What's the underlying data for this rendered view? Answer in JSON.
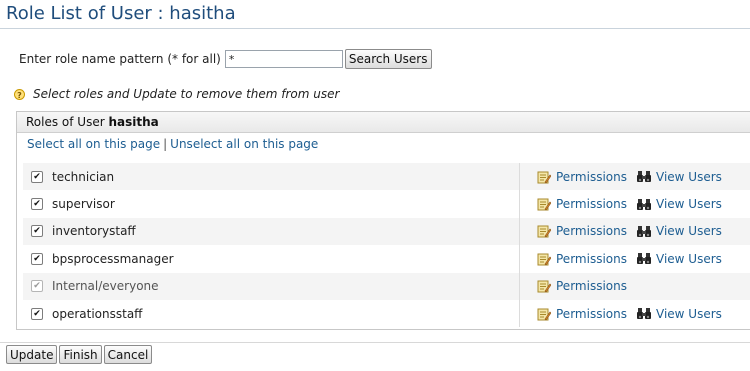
{
  "page": {
    "title": "Role List of User : hasitha"
  },
  "search": {
    "label": "Enter role name pattern (* for all)",
    "value": "*",
    "button_label": "Search Users"
  },
  "hint": {
    "icon": "help-icon",
    "text": "Select roles and Update to remove them from user"
  },
  "panel": {
    "header_prefix": "Roles of User",
    "header_user": "hasitha",
    "select_all_label": "Select all on this page",
    "separator": "|",
    "unselect_all_label": "Unselect all on this page"
  },
  "roles": [
    {
      "name": "technician",
      "checked": true,
      "disabled": false,
      "permissions_label": "Permissions",
      "view_users_label": "View Users"
    },
    {
      "name": "supervisor",
      "checked": true,
      "disabled": false,
      "permissions_label": "Permissions",
      "view_users_label": "View Users"
    },
    {
      "name": "inventorystaff",
      "checked": true,
      "disabled": false,
      "permissions_label": "Permissions",
      "view_users_label": "View Users"
    },
    {
      "name": "bpsprocessmanager",
      "checked": true,
      "disabled": false,
      "permissions_label": "Permissions",
      "view_users_label": "View Users"
    },
    {
      "name": "Internal/everyone",
      "checked": true,
      "disabled": true,
      "permissions_label": "Permissions",
      "view_users_label": null
    },
    {
      "name": "operationsstaff",
      "checked": true,
      "disabled": false,
      "permissions_label": "Permissions",
      "view_users_label": "View Users"
    }
  ],
  "actions": {
    "update_label": "Update",
    "finish_label": "Finish",
    "cancel_label": "Cancel"
  },
  "colors": {
    "title": "#1f4d7c",
    "link": "#1d5d91",
    "row_alt": "#f4f4f4"
  }
}
